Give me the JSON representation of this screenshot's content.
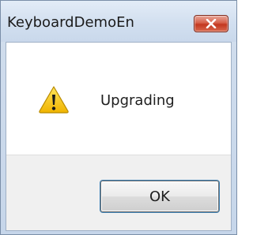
{
  "window": {
    "title": "KeyboardDemoEn",
    "close_icon": "close-icon"
  },
  "message": {
    "icon": "warning-icon",
    "text": "Upgrading"
  },
  "buttons": {
    "ok_label": "OK"
  },
  "colors": {
    "close_button": "#c3371f",
    "warning_fill": "#f5c400"
  }
}
